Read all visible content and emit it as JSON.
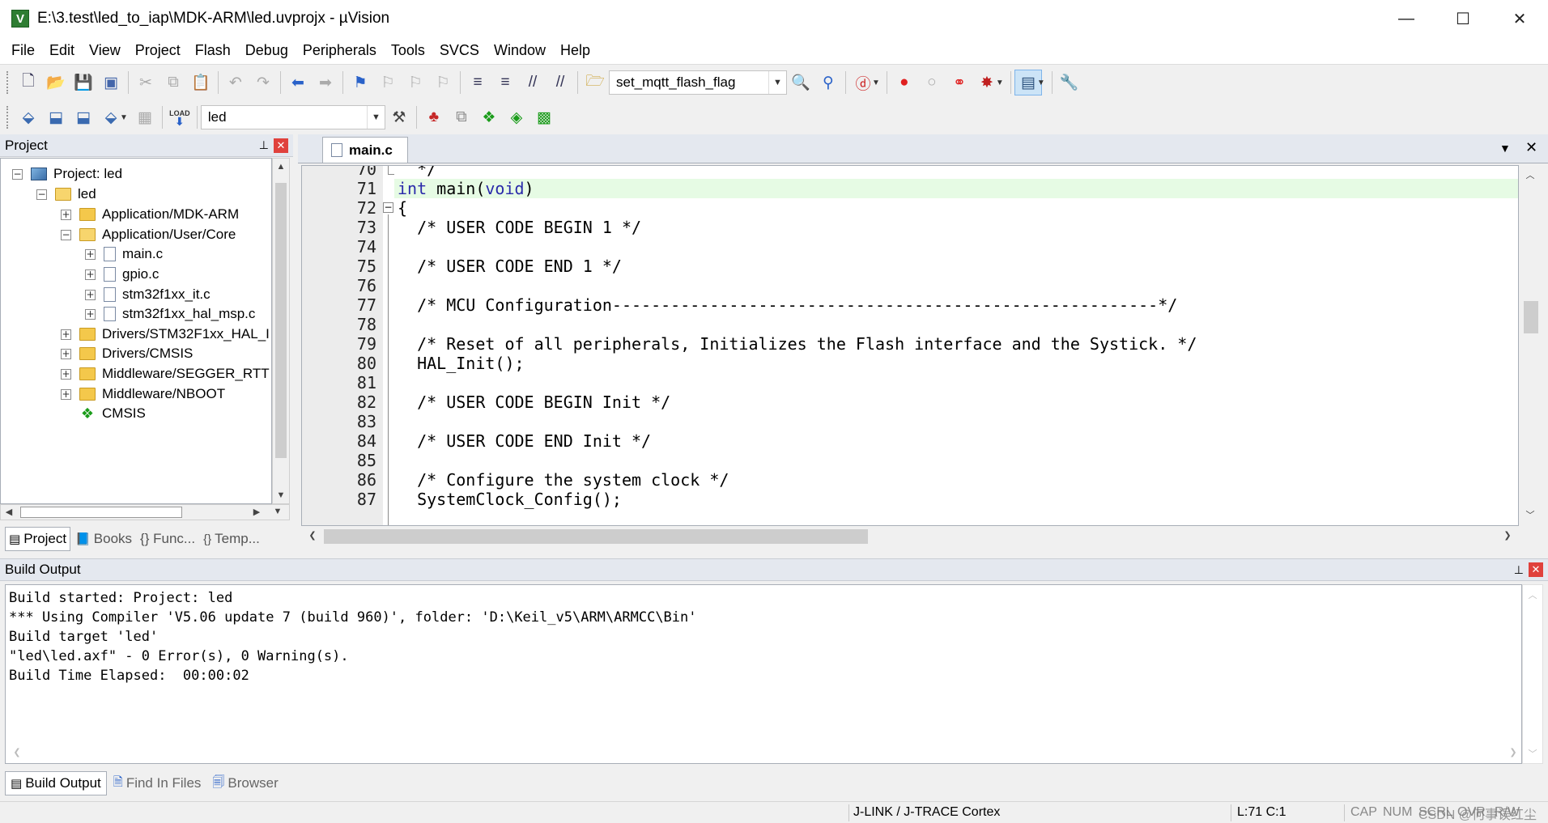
{
  "window": {
    "title": "E:\\3.test\\led_to_iap\\MDK-ARM\\led.uvprojx - µVision",
    "app_icon": "V",
    "minimize_glyph": "—",
    "maximize_glyph": "☐",
    "close_glyph": "✕"
  },
  "menu": [
    "File",
    "Edit",
    "View",
    "Project",
    "Flash",
    "Debug",
    "Peripherals",
    "Tools",
    "SVCS",
    "Window",
    "Help"
  ],
  "toolbar1": {
    "find_combo_value": "set_mqtt_flash_flag"
  },
  "toolbar2": {
    "target_combo_value": "led",
    "load_label": "LOAD"
  },
  "project_panel": {
    "title": "Project",
    "pin_glyph": "⊥",
    "close_glyph": "✕",
    "tree": [
      {
        "label": "Project: led",
        "expander": "−"
      },
      {
        "label": "led",
        "expander": "−"
      },
      {
        "label": "Application/MDK-ARM",
        "expander": "+"
      },
      {
        "label": "Application/User/Core",
        "expander": "−"
      },
      {
        "label": "main.c",
        "expander": "+"
      },
      {
        "label": "gpio.c",
        "expander": "+"
      },
      {
        "label": "stm32f1xx_it.c",
        "expander": "+"
      },
      {
        "label": "stm32f1xx_hal_msp.c",
        "expander": "+"
      },
      {
        "label": "Drivers/STM32F1xx_HAL_I",
        "expander": "+"
      },
      {
        "label": "Drivers/CMSIS",
        "expander": "+"
      },
      {
        "label": "Middleware/SEGGER_RTT",
        "expander": "+"
      },
      {
        "label": "Middleware/NBOOT",
        "expander": "+"
      },
      {
        "label": "CMSIS",
        "expander": ""
      }
    ],
    "tabs": [
      "Project",
      "Books",
      "{} Func...",
      "Temp..."
    ]
  },
  "editor": {
    "tab": "main.c",
    "dropdown_glyph": "▼",
    "close_glyph": "✕",
    "cursor_line": 71,
    "lines": [
      {
        "n": "70",
        "text": "  */"
      },
      {
        "n": "71",
        "text": "int main(void)"
      },
      {
        "n": "72",
        "text": "{"
      },
      {
        "n": "73",
        "text": "  /* USER CODE BEGIN 1 */"
      },
      {
        "n": "74",
        "text": ""
      },
      {
        "n": "75",
        "text": "  /* USER CODE END 1 */"
      },
      {
        "n": "76",
        "text": ""
      },
      {
        "n": "77",
        "text": "  /* MCU Configuration--------------------------------------------------------*/"
      },
      {
        "n": "78",
        "text": ""
      },
      {
        "n": "79",
        "text": "  /* Reset of all peripherals, Initializes the Flash interface and the Systick. */"
      },
      {
        "n": "80",
        "text": "  HAL_Init();"
      },
      {
        "n": "81",
        "text": ""
      },
      {
        "n": "82",
        "text": "  /* USER CODE BEGIN Init */"
      },
      {
        "n": "83",
        "text": ""
      },
      {
        "n": "84",
        "text": "  /* USER CODE END Init */"
      },
      {
        "n": "85",
        "text": ""
      },
      {
        "n": "86",
        "text": "  /* Configure the system clock */"
      },
      {
        "n": "87",
        "text": "  SystemClock_Config();"
      }
    ]
  },
  "build_output": {
    "title": "Build Output",
    "lines": [
      "Build started: Project: led",
      "*** Using Compiler 'V5.06 update 7 (build 960)', folder: 'D:\\Keil_v5\\ARM\\ARMCC\\Bin'",
      "Build target 'led'",
      "\"led\\led.axf\" - 0 Error(s), 0 Warning(s).",
      "Build Time Elapsed:  00:00:02"
    ],
    "tabs": [
      "Build Output",
      "Find In Files",
      "Browser"
    ]
  },
  "status": {
    "debugger": "J-LINK / J-TRACE Cortex",
    "position": "L:71 C:1",
    "keys": [
      "CAP",
      "NUM",
      "SCRL",
      "OVR",
      "R/W"
    ],
    "watermark": "CSDN @何事误红尘"
  }
}
